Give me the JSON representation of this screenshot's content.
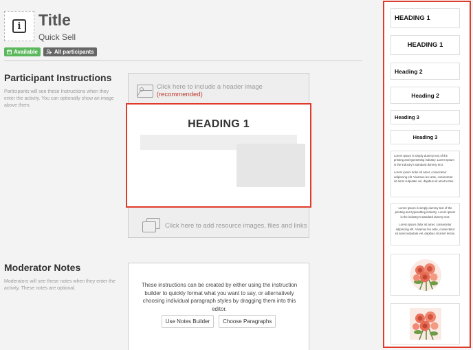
{
  "header": {
    "title": "Title",
    "subtitle": "Quick Sell",
    "icon": "info-icon",
    "badges": [
      {
        "label": "Available",
        "icon": "calendar-icon",
        "color": "#5cb85c"
      },
      {
        "label": "All participants",
        "icon": "users-icon",
        "color": "#666666"
      }
    ]
  },
  "participant_instructions": {
    "title": "Participant Instructions",
    "description": "Participants will see these Instructions when they enter the activity. You can optionally show an image above them.",
    "header_image_prompt": "Click here to include a header image",
    "header_image_recommended": "(recommended)",
    "editor_heading": "HEADING 1",
    "resource_prompt": "Click here to add resource images, files and links"
  },
  "moderator_notes": {
    "title": "Moderator Notes",
    "description": "Moderators will see these notes when they enter the activity. These notes are optional.",
    "body": "These instructions can be created by either using the instruction builder to quickly format what you want to say, or alternatively choosing individual paragraph styles by dragging them into this editor.",
    "buttons": [
      "Use Notes Builder",
      "Choose Paragraphs"
    ]
  },
  "sidebar": {
    "items": [
      {
        "type": "heading",
        "level": 1,
        "align": "left",
        "label": "HEADING 1"
      },
      {
        "type": "heading",
        "level": 1,
        "align": "center",
        "label": "HEADING 1"
      },
      {
        "type": "heading",
        "level": 2,
        "align": "left",
        "label": "Heading 2"
      },
      {
        "type": "heading",
        "level": 2,
        "align": "center",
        "label": "Heading 2"
      },
      {
        "type": "heading",
        "level": 3,
        "align": "left",
        "label": "Heading 3"
      },
      {
        "type": "heading",
        "level": 3,
        "align": "center",
        "label": "Heading 3"
      },
      {
        "type": "paragraph",
        "align": "left",
        "p1": "Lorem Ipsum is simply dummy text of the printing and typesetting industry. Lorem Ipsum is the industry's standard dummy text.",
        "p2": "Lorem ipsum dolor sit amet, consectetur adipiscing elit. Vivamus leo ante, consectetur sit amet vulputate vel, dapibus sit amet lectus."
      },
      {
        "type": "paragraph",
        "align": "center",
        "p1": "Lorem Ipsum is simply dummy text of the printing and typesetting industry. Lorem Ipsum is the industry's standard dummy text.",
        "p2": "Lorem ipsum dolor sit amet, consectetur adipiscing elit. Vivamus leo ante, consectetur sit amet vulputate vel, dapibus sit amet lectus."
      },
      {
        "type": "image",
        "shape": "circle",
        "icon": "roses-image"
      },
      {
        "type": "image",
        "shape": "square",
        "icon": "roses-image"
      }
    ]
  },
  "colors": {
    "highlight": "#e03a2b",
    "available_badge": "#5cb85c",
    "participants_badge": "#666666",
    "recommended": "#c0392b"
  }
}
